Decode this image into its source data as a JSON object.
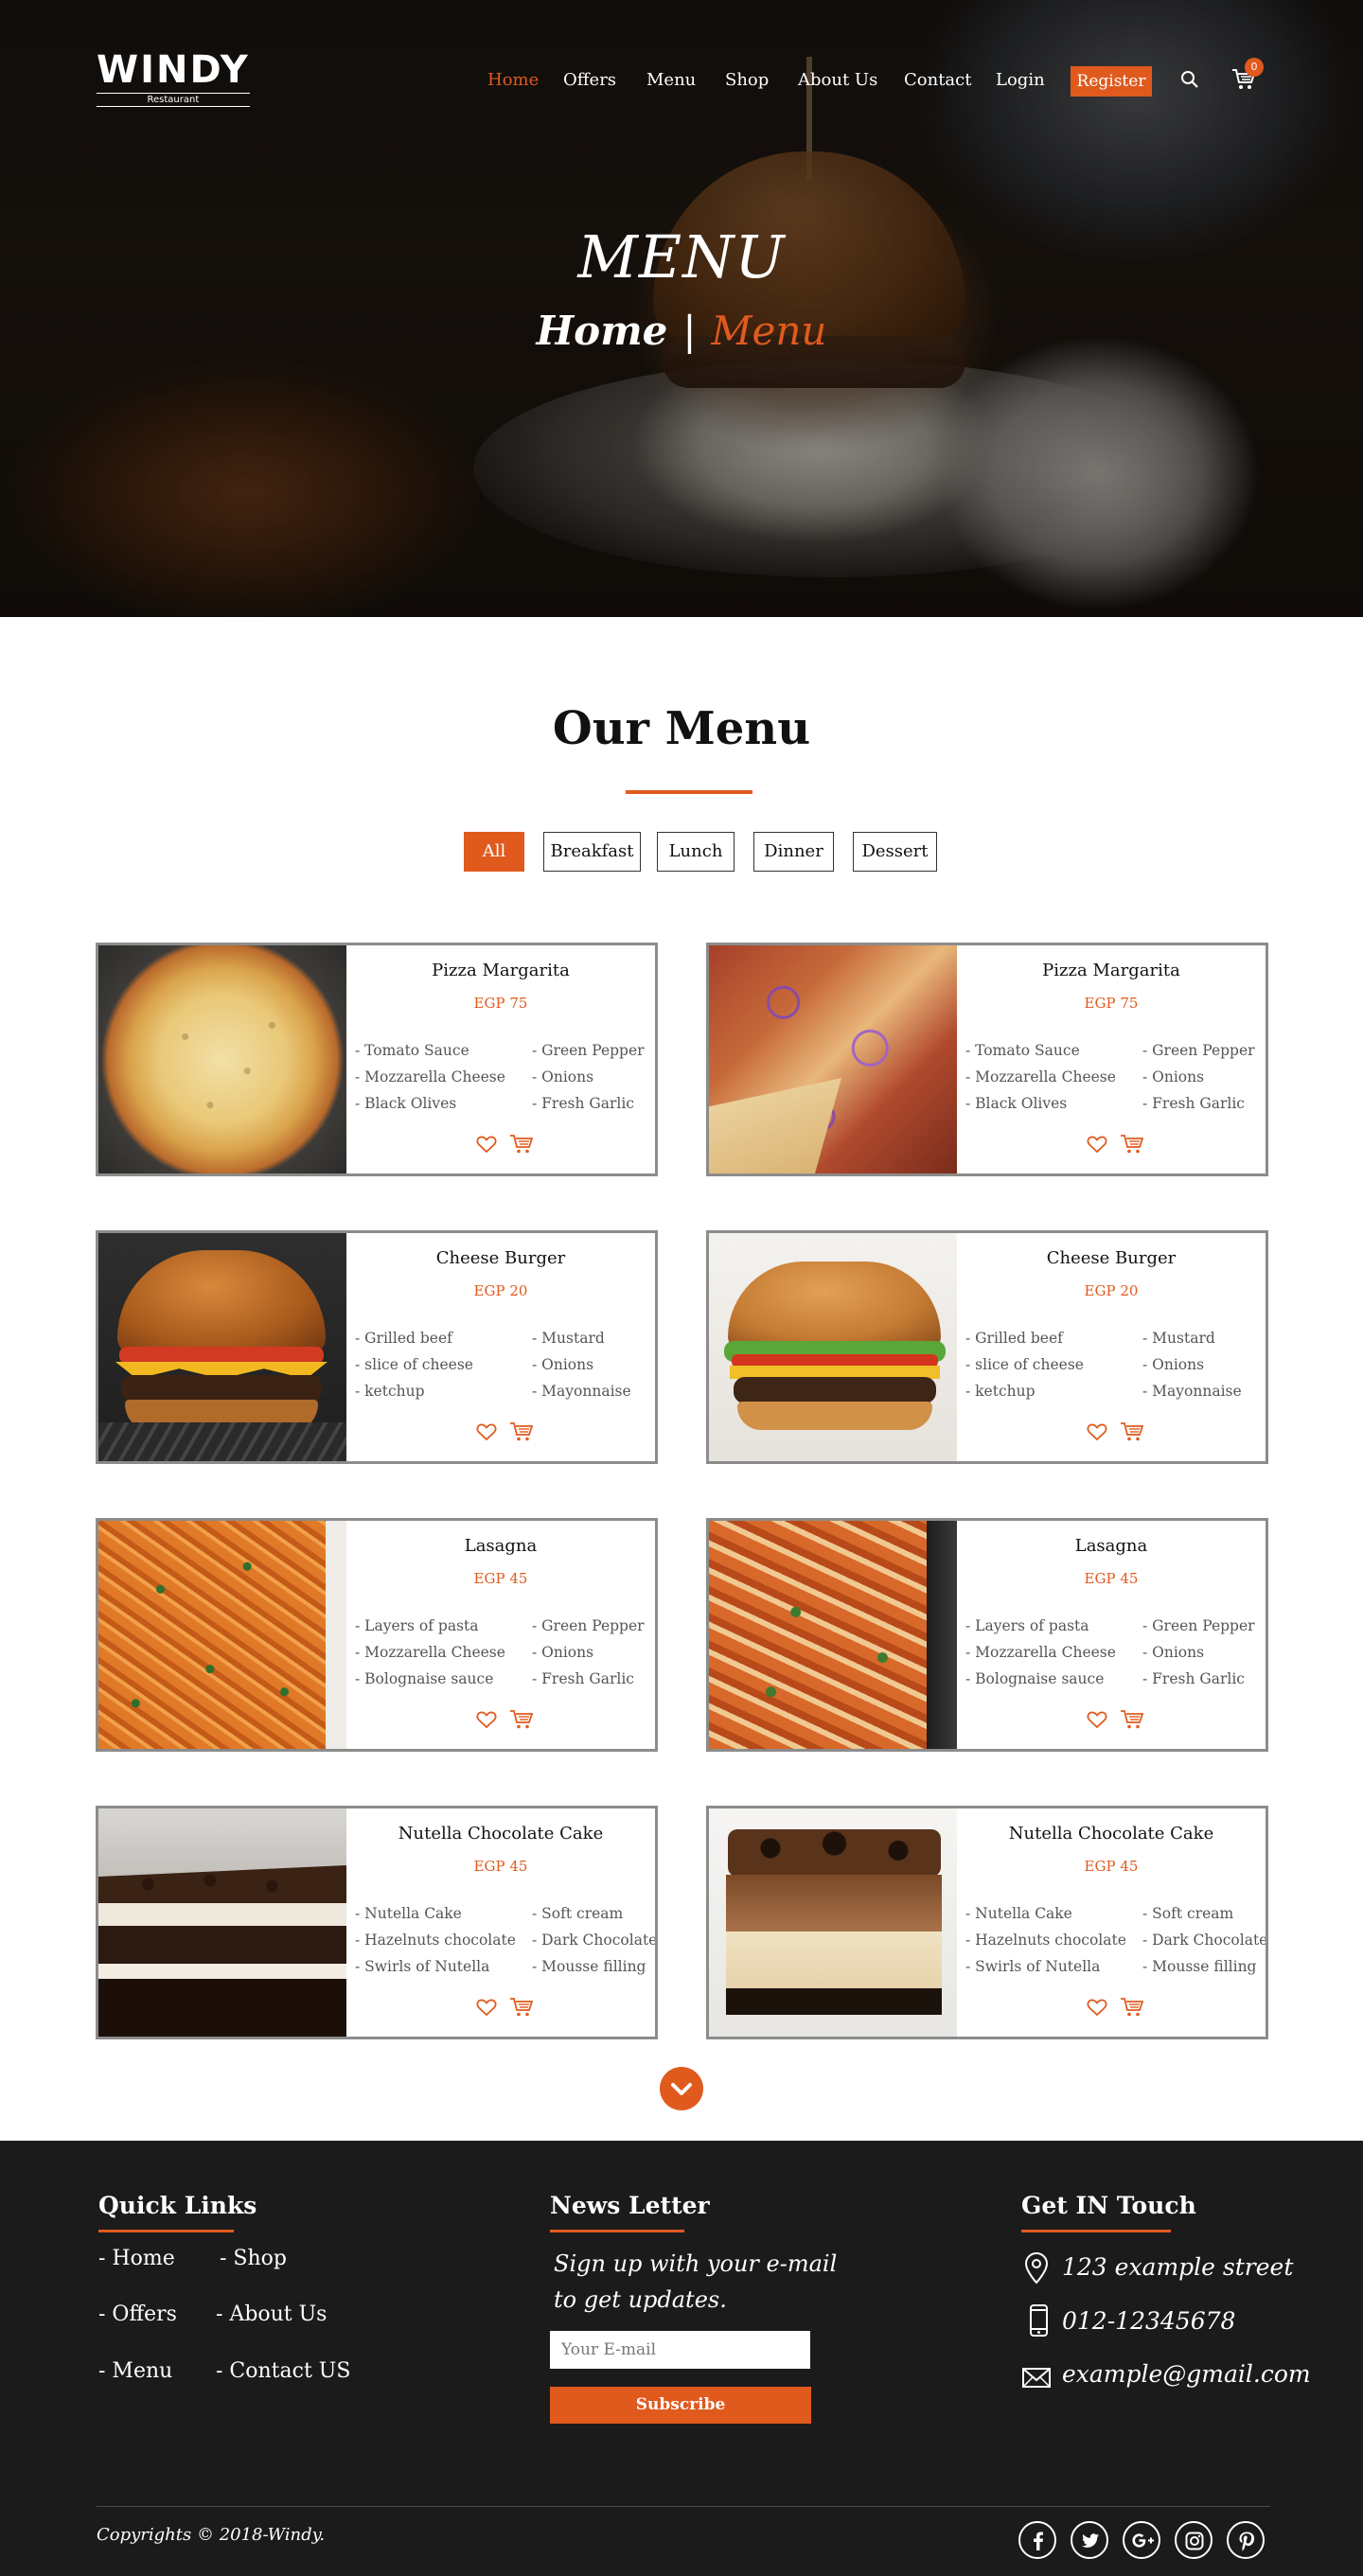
{
  "brand": {
    "name": "WINDY",
    "tagline": "Restaurant"
  },
  "nav": {
    "items": [
      "Home",
      "Offers",
      "Menu",
      "Shop",
      "About Us",
      "Contact",
      "Login"
    ],
    "register": "Register",
    "cart_count": "0",
    "icons": {
      "search": "search-icon",
      "cart": "cart-icon"
    }
  },
  "hero": {
    "title": "MENU",
    "crumb_home": "Home",
    "crumb_sep": "|",
    "crumb_current": "Menu"
  },
  "menu": {
    "title": "Our Menu",
    "filters": [
      "All",
      "Breakfast",
      "Lunch",
      "Dinner",
      "Dessert"
    ],
    "active_filter": "All",
    "cards": [
      {
        "name": "Pizza Margarita",
        "price": "EGP 75",
        "left": [
          "- Tomato Sauce",
          "- Mozzarella Cheese",
          "- Black Olives"
        ],
        "right": [
          "- Green Pepper",
          "- Onions",
          "- Fresh Garlic"
        ]
      },
      {
        "name": "Pizza Margarita",
        "price": "EGP 75",
        "left": [
          "- Tomato Sauce",
          "- Mozzarella Cheese",
          "- Black Olives"
        ],
        "right": [
          "- Green Pepper",
          "- Onions",
          "- Fresh Garlic"
        ]
      },
      {
        "name": "Cheese Burger",
        "price": "EGP 20",
        "left": [
          "- Grilled beef",
          "- slice of cheese",
          "- ketchup"
        ],
        "right": [
          "- Mustard",
          "- Onions",
          "- Mayonnaise"
        ]
      },
      {
        "name": "Cheese Burger",
        "price": "EGP 20",
        "left": [
          "- Grilled beef",
          "- slice of cheese",
          "- ketchup"
        ],
        "right": [
          "- Mustard",
          "- Onions",
          "- Mayonnaise"
        ]
      },
      {
        "name": "Lasagna",
        "price": "EGP 45",
        "left": [
          "- Layers of pasta",
          "- Mozzarella Cheese",
          "- Bolognaise sauce"
        ],
        "right": [
          "- Green Pepper",
          "- Onions",
          "- Fresh Garlic"
        ]
      },
      {
        "name": "Lasagna",
        "price": "EGP 45",
        "left": [
          "- Layers of pasta",
          "- Mozzarella Cheese",
          "- Bolognaise sauce"
        ],
        "right": [
          "- Green Pepper",
          "- Onions",
          "- Fresh Garlic"
        ]
      },
      {
        "name": "Nutella Chocolate Cake",
        "price": "EGP 45",
        "left": [
          "- Nutella Cake",
          "- Hazelnuts chocolate",
          "- Swirls of Nutella"
        ],
        "right": [
          "- Soft cream",
          "- Dark Chocolate",
          "- Mousse filling"
        ]
      },
      {
        "name": "Nutella Chocolate Cake",
        "price": "EGP 45",
        "left": [
          "- Nutella Cake",
          "- Hazelnuts chocolate",
          "- Swirls of Nutella"
        ],
        "right": [
          "- Soft cream",
          "- Dark Chocolate",
          "- Mousse filling"
        ]
      }
    ]
  },
  "footer": {
    "quick_links_title": "Quick Links",
    "quick_links": [
      "- Home",
      "- Shop",
      "- Offers",
      "- About Us",
      "- Menu",
      "- Contact US"
    ],
    "newsletter_title": "News Letter",
    "newsletter_text_1": "Sign up with your e-mail",
    "newsletter_text_2": "to get updates.",
    "email_placeholder": "Your E-mail",
    "subscribe": "Subscribe",
    "contact_title": "Get IN Touch",
    "address": "123 example street",
    "phone": "012-12345678",
    "email": "example@gmail.com",
    "copyright": "Copyrights © 2018-Windy.",
    "social_icons": [
      "facebook-icon",
      "twitter-icon",
      "google-plus-icon",
      "instagram-icon",
      "pinterest-icon"
    ]
  },
  "colors": {
    "accent": "#e05a1e",
    "footer_bg": "#1b1b1b",
    "card_border": "#8c8c8c"
  }
}
